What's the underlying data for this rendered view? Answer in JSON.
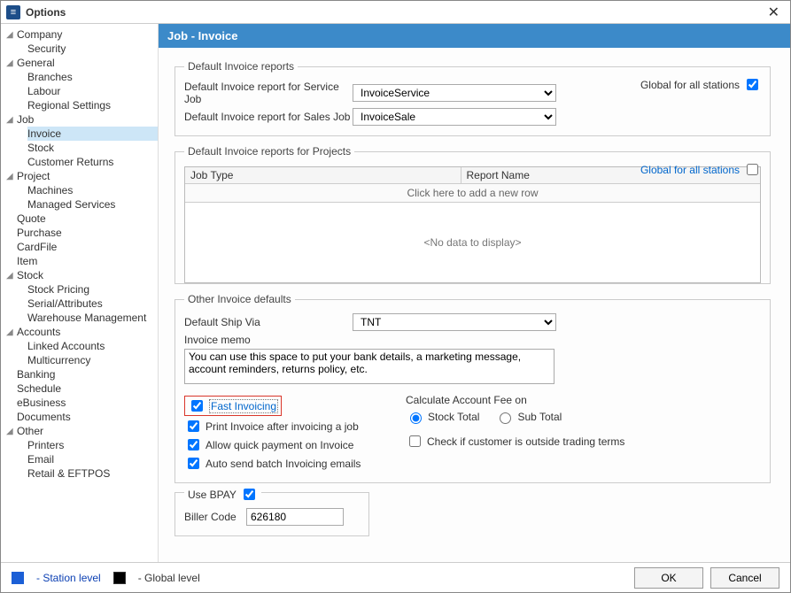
{
  "window": {
    "title": "Options"
  },
  "sidebar": {
    "groups": [
      {
        "label": "Company",
        "children": [
          "Security"
        ]
      },
      {
        "label": "General",
        "children": [
          "Branches",
          "Labour",
          "Regional Settings"
        ]
      },
      {
        "label": "Job",
        "children": [
          "Invoice",
          "Stock",
          "Customer Returns"
        ]
      },
      {
        "label": "Project",
        "children": [
          "Machines",
          "Managed Services"
        ]
      },
      {
        "label": "Quote",
        "children": []
      },
      {
        "label": "Purchase",
        "children": []
      },
      {
        "label": "CardFile",
        "children": []
      },
      {
        "label": "Item",
        "children": []
      },
      {
        "label": "Stock",
        "children": [
          "Stock Pricing",
          "Serial/Attributes",
          "Warehouse Management"
        ]
      },
      {
        "label": "Accounts",
        "children": [
          "Linked Accounts",
          "Multicurrency"
        ]
      },
      {
        "label": "Banking",
        "children": []
      },
      {
        "label": "Schedule",
        "children": []
      },
      {
        "label": "eBusiness",
        "children": []
      },
      {
        "label": "Documents",
        "children": []
      },
      {
        "label": "Other",
        "children": [
          "Printers",
          "Email",
          "Retail & EFTPOS"
        ]
      }
    ],
    "selected": "Invoice"
  },
  "content": {
    "header": "Job - Invoice",
    "section1": {
      "legend": "Default Invoice reports",
      "global_label": "Global for all stations",
      "global_checked": true,
      "rows": [
        {
          "label": "Default Invoice report for Service Job",
          "value": "InvoiceService"
        },
        {
          "label": "Default Invoice report for Sales Job",
          "value": "InvoiceSale"
        }
      ]
    },
    "section2": {
      "legend": "Default Invoice reports for Projects",
      "global_label": "Global for all stations",
      "global_checked": false,
      "grid": {
        "cols": [
          "Job Type",
          "Report Name"
        ],
        "newrow": "Click here to add a new row",
        "empty": "<No data to display>"
      }
    },
    "section3": {
      "legend": "Other Invoice defaults",
      "shipvia_label": "Default Ship Via",
      "shipvia_value": "TNT",
      "memo_label": "Invoice memo",
      "memo_value": "You can use this space to put your bank details, a marketing message, account reminders, returns policy, etc.",
      "fast_label": "Fast Invoicing",
      "fast_checked": true,
      "print_label": "Print Invoice after invoicing a job",
      "print_checked": true,
      "quick_label": "Allow quick payment on Invoice",
      "quick_checked": true,
      "batch_label": "Auto send batch Invoicing emails",
      "batch_checked": true,
      "calc_label": "Calculate Account Fee on",
      "radio_stock": "Stock Total",
      "radio_sub": "Sub Total",
      "radio_selected": "stock",
      "trading_label": "Check if customer is outside trading terms",
      "trading_checked": false
    },
    "section4": {
      "bpay_label": "Use BPAY",
      "bpay_checked": true,
      "biller_label": "Biller Code",
      "biller_value": "626180"
    }
  },
  "footer": {
    "station": "- Station level",
    "global": "- Global level",
    "ok": "OK",
    "cancel": "Cancel"
  }
}
